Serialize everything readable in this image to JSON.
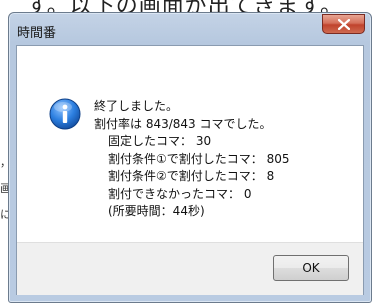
{
  "background": {
    "top_text": "す。以下の画面が出てきます。",
    "side_text": [
      "，",
      "画",
      "に"
    ]
  },
  "dialog": {
    "title": "時間番",
    "icon": "info-icon",
    "message_lines": [
      "終了しました。",
      "割付率は 843/843 コマでした。"
    ],
    "detail_lines": [
      "固定したコマ： 30",
      "割付条件①で割付したコマ： 805",
      "割付条件②で割付したコマ：  8",
      "割付できなかったコマ：  0",
      "(所要時間：44秒)"
    ],
    "ok_label": "OK",
    "close_icon": "close-icon"
  },
  "colors": {
    "frame": "#b9cbe2",
    "close_button": "#c0432d",
    "info_icon": "#1f6fd0",
    "footer": "#f0f0f0"
  }
}
